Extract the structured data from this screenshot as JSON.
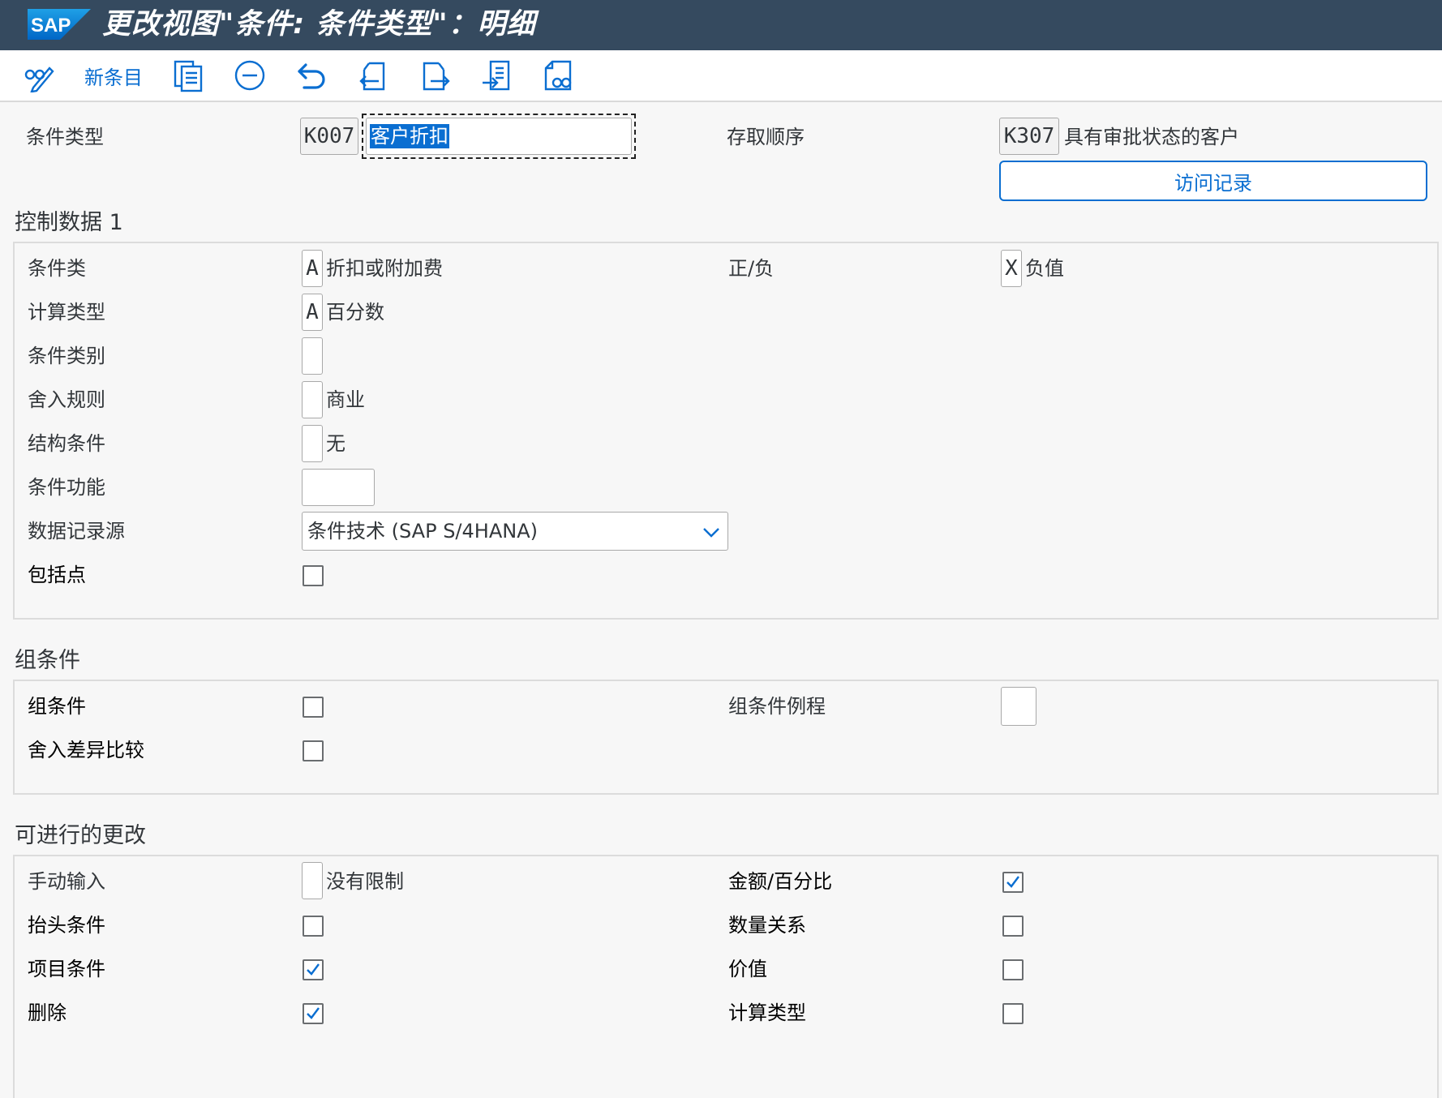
{
  "window": {
    "title": "更改视图\"条件: 条件类型\"：明细"
  },
  "logo": {
    "text": "SAP"
  },
  "toolbar": {
    "new_entries_label": "新条目",
    "icons": [
      "edit-glasses-icon",
      "copy-icon",
      "delete-icon",
      "undo-icon",
      "previous-entry-icon",
      "next-entry-icon",
      "import-icon",
      "where-used-icon"
    ]
  },
  "header": {
    "condition_type_label": "条件类型",
    "condition_type_code": "K007",
    "condition_type_desc": "客户折扣",
    "access_sequence_label": "存取顺序",
    "access_sequence_code": "K307",
    "access_sequence_desc": "具有审批状态的客户",
    "access_records_button": "访问记录"
  },
  "control1": {
    "title": "控制数据 1",
    "condition_class_label": "条件类",
    "condition_class_code": "A",
    "condition_class_desc": "折扣或附加费",
    "plus_minus_label": "正/负",
    "plus_minus_code": "X",
    "plus_minus_desc": "负值",
    "calc_type_label": "计算类型",
    "calc_type_code": "A",
    "calc_type_desc": "百分数",
    "condition_category_label": "条件类别",
    "condition_category_code": "",
    "rounding_rule_label": "舍入规则",
    "rounding_rule_code": "",
    "rounding_rule_desc": "商业",
    "structure_cond_label": "结构条件",
    "structure_cond_code": "",
    "structure_cond_desc": "无",
    "cond_function_label": "条件功能",
    "cond_function_value": "",
    "record_source_label": "数据记录源",
    "record_source_value": "条件技术 (SAP S/4HANA)",
    "inclusion_point_label": "包括点",
    "inclusion_point_checked": false
  },
  "group_cond": {
    "title": "组条件",
    "group_cond_label": "组条件",
    "group_cond_checked": false,
    "group_routine_label": "组条件例程",
    "group_routine_value": "",
    "round_diff_label": "舍入差异比较",
    "round_diff_checked": false
  },
  "changes": {
    "title": "可进行的更改",
    "manual_entry_label": "手动输入",
    "manual_entry_code": "",
    "manual_entry_desc": "没有限制",
    "amount_percent_label": "金额/百分比",
    "amount_percent_checked": true,
    "header_cond_label": "抬头条件",
    "header_cond_checked": false,
    "qty_relation_label": "数量关系",
    "qty_relation_checked": false,
    "item_cond_label": "项目条件",
    "item_cond_checked": true,
    "value_label": "价值",
    "value_checked": false,
    "delete_label": "删除",
    "delete_checked": true,
    "calc_type_label": "计算类型",
    "calc_type_checked": false
  },
  "colors": {
    "header_bg": "#354a5f",
    "accent": "#0a6ed1",
    "selection": "#0a6ed1"
  }
}
